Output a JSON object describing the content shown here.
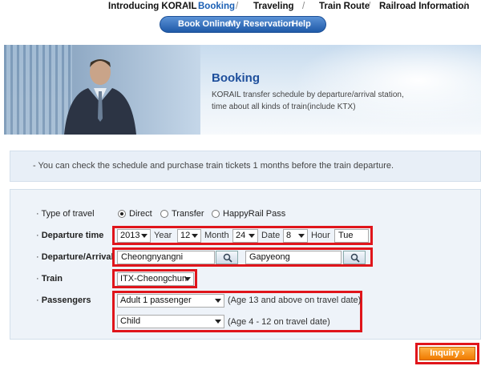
{
  "nav": {
    "items": [
      "Introducing KORAIL",
      "Booking",
      "Traveling",
      "Train Route",
      "Railroad Information"
    ],
    "separator": "/"
  },
  "subnav": {
    "items": [
      "Book Online",
      "My Reservation",
      "Help"
    ]
  },
  "banner": {
    "title": "Booking",
    "description": "KORAIL transfer schedule by departure/arrival station, time about all kinds of train(include KTX)"
  },
  "notice": "- You can check the schedule and purchase train tickets 1 months before the train departure.",
  "form": {
    "bullet": "·",
    "type_label": "Type of travel",
    "type_options": [
      "Direct",
      "Transfer",
      "HappyRail Pass"
    ],
    "type_selected": "Direct",
    "departure_time_label": "Departure time",
    "year": "2013",
    "year_unit": "Year",
    "month": "12",
    "month_unit": "Month",
    "date": "24",
    "date_unit": "Date",
    "hour": "8",
    "hour_unit": "Hour",
    "weekday": "Tue",
    "dep_arr_label": "Departure/Arrival",
    "departure_station": "Cheongnyangni",
    "arrival_station": "Gapyeong",
    "train_label": "Train",
    "train_value": "ITX-Cheongchun",
    "passengers_label": "Passengers",
    "adult_value": "Adult 1 passenger",
    "adult_note": "(Age 13 and above on travel date)",
    "child_value": "Child",
    "child_note": "(Age 4 - 12 on travel date)"
  },
  "inquiry_label": "Inquiry ›",
  "colors": {
    "highlight": "#e0151b",
    "accent_blue": "#1e4f9c",
    "button_orange": "#f07a00"
  }
}
